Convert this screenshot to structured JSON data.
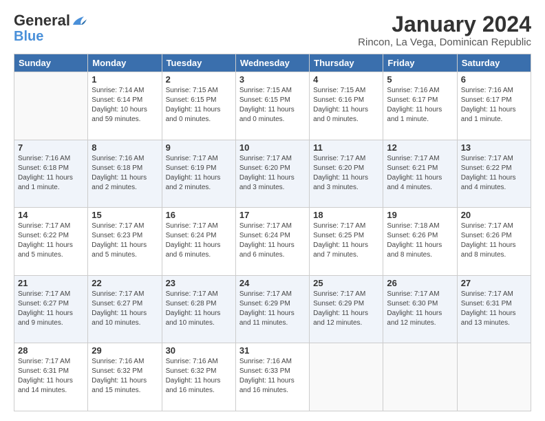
{
  "logo": {
    "line1": "General",
    "line2": "Blue"
  },
  "title": "January 2024",
  "subtitle": "Rincon, La Vega, Dominican Republic",
  "headers": [
    "Sunday",
    "Monday",
    "Tuesday",
    "Wednesday",
    "Thursday",
    "Friday",
    "Saturday"
  ],
  "weeks": [
    [
      {
        "day": "",
        "info": ""
      },
      {
        "day": "1",
        "info": "Sunrise: 7:14 AM\nSunset: 6:14 PM\nDaylight: 10 hours\nand 59 minutes."
      },
      {
        "day": "2",
        "info": "Sunrise: 7:15 AM\nSunset: 6:15 PM\nDaylight: 11 hours\nand 0 minutes."
      },
      {
        "day": "3",
        "info": "Sunrise: 7:15 AM\nSunset: 6:15 PM\nDaylight: 11 hours\nand 0 minutes."
      },
      {
        "day": "4",
        "info": "Sunrise: 7:15 AM\nSunset: 6:16 PM\nDaylight: 11 hours\nand 0 minutes."
      },
      {
        "day": "5",
        "info": "Sunrise: 7:16 AM\nSunset: 6:17 PM\nDaylight: 11 hours\nand 1 minute."
      },
      {
        "day": "6",
        "info": "Sunrise: 7:16 AM\nSunset: 6:17 PM\nDaylight: 11 hours\nand 1 minute."
      }
    ],
    [
      {
        "day": "7",
        "info": "Sunrise: 7:16 AM\nSunset: 6:18 PM\nDaylight: 11 hours\nand 1 minute."
      },
      {
        "day": "8",
        "info": "Sunrise: 7:16 AM\nSunset: 6:18 PM\nDaylight: 11 hours\nand 2 minutes."
      },
      {
        "day": "9",
        "info": "Sunrise: 7:17 AM\nSunset: 6:19 PM\nDaylight: 11 hours\nand 2 minutes."
      },
      {
        "day": "10",
        "info": "Sunrise: 7:17 AM\nSunset: 6:20 PM\nDaylight: 11 hours\nand 3 minutes."
      },
      {
        "day": "11",
        "info": "Sunrise: 7:17 AM\nSunset: 6:20 PM\nDaylight: 11 hours\nand 3 minutes."
      },
      {
        "day": "12",
        "info": "Sunrise: 7:17 AM\nSunset: 6:21 PM\nDaylight: 11 hours\nand 4 minutes."
      },
      {
        "day": "13",
        "info": "Sunrise: 7:17 AM\nSunset: 6:22 PM\nDaylight: 11 hours\nand 4 minutes."
      }
    ],
    [
      {
        "day": "14",
        "info": "Sunrise: 7:17 AM\nSunset: 6:22 PM\nDaylight: 11 hours\nand 5 minutes."
      },
      {
        "day": "15",
        "info": "Sunrise: 7:17 AM\nSunset: 6:23 PM\nDaylight: 11 hours\nand 5 minutes."
      },
      {
        "day": "16",
        "info": "Sunrise: 7:17 AM\nSunset: 6:24 PM\nDaylight: 11 hours\nand 6 minutes."
      },
      {
        "day": "17",
        "info": "Sunrise: 7:17 AM\nSunset: 6:24 PM\nDaylight: 11 hours\nand 6 minutes."
      },
      {
        "day": "18",
        "info": "Sunrise: 7:17 AM\nSunset: 6:25 PM\nDaylight: 11 hours\nand 7 minutes."
      },
      {
        "day": "19",
        "info": "Sunrise: 7:18 AM\nSunset: 6:26 PM\nDaylight: 11 hours\nand 8 minutes."
      },
      {
        "day": "20",
        "info": "Sunrise: 7:17 AM\nSunset: 6:26 PM\nDaylight: 11 hours\nand 8 minutes."
      }
    ],
    [
      {
        "day": "21",
        "info": "Sunrise: 7:17 AM\nSunset: 6:27 PM\nDaylight: 11 hours\nand 9 minutes."
      },
      {
        "day": "22",
        "info": "Sunrise: 7:17 AM\nSunset: 6:27 PM\nDaylight: 11 hours\nand 10 minutes."
      },
      {
        "day": "23",
        "info": "Sunrise: 7:17 AM\nSunset: 6:28 PM\nDaylight: 11 hours\nand 10 minutes."
      },
      {
        "day": "24",
        "info": "Sunrise: 7:17 AM\nSunset: 6:29 PM\nDaylight: 11 hours\nand 11 minutes."
      },
      {
        "day": "25",
        "info": "Sunrise: 7:17 AM\nSunset: 6:29 PM\nDaylight: 11 hours\nand 12 minutes."
      },
      {
        "day": "26",
        "info": "Sunrise: 7:17 AM\nSunset: 6:30 PM\nDaylight: 11 hours\nand 12 minutes."
      },
      {
        "day": "27",
        "info": "Sunrise: 7:17 AM\nSunset: 6:31 PM\nDaylight: 11 hours\nand 13 minutes."
      }
    ],
    [
      {
        "day": "28",
        "info": "Sunrise: 7:17 AM\nSunset: 6:31 PM\nDaylight: 11 hours\nand 14 minutes."
      },
      {
        "day": "29",
        "info": "Sunrise: 7:16 AM\nSunset: 6:32 PM\nDaylight: 11 hours\nand 15 minutes."
      },
      {
        "day": "30",
        "info": "Sunrise: 7:16 AM\nSunset: 6:32 PM\nDaylight: 11 hours\nand 16 minutes."
      },
      {
        "day": "31",
        "info": "Sunrise: 7:16 AM\nSunset: 6:33 PM\nDaylight: 11 hours\nand 16 minutes."
      },
      {
        "day": "",
        "info": ""
      },
      {
        "day": "",
        "info": ""
      },
      {
        "day": "",
        "info": ""
      }
    ]
  ]
}
